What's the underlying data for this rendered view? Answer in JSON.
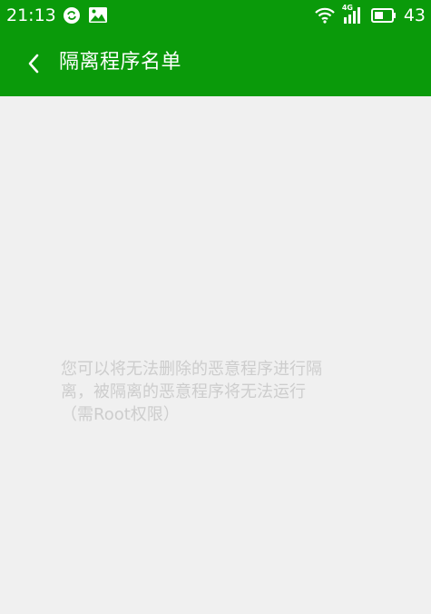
{
  "status_bar": {
    "time": "21:13",
    "battery": "43",
    "network": "4G",
    "left_icons": [
      "sync-icon",
      "image-icon"
    ],
    "right_icons": [
      "wifi-icon",
      "signal-icon",
      "battery-icon"
    ]
  },
  "app_bar": {
    "title": "隔离程序名单",
    "back_icon": "chevron-left-icon",
    "color": "#0a9a0a"
  },
  "empty_state": {
    "lines": [
      "您可以将无法删除的恶意程序进行隔",
      "离，被隔离的恶意程序将无法运行",
      "（需Root权限）"
    ]
  },
  "colors": {
    "accent": "#0a9a0a",
    "background": "#f0f0f0",
    "hint_text": "#cdcdcd"
  }
}
